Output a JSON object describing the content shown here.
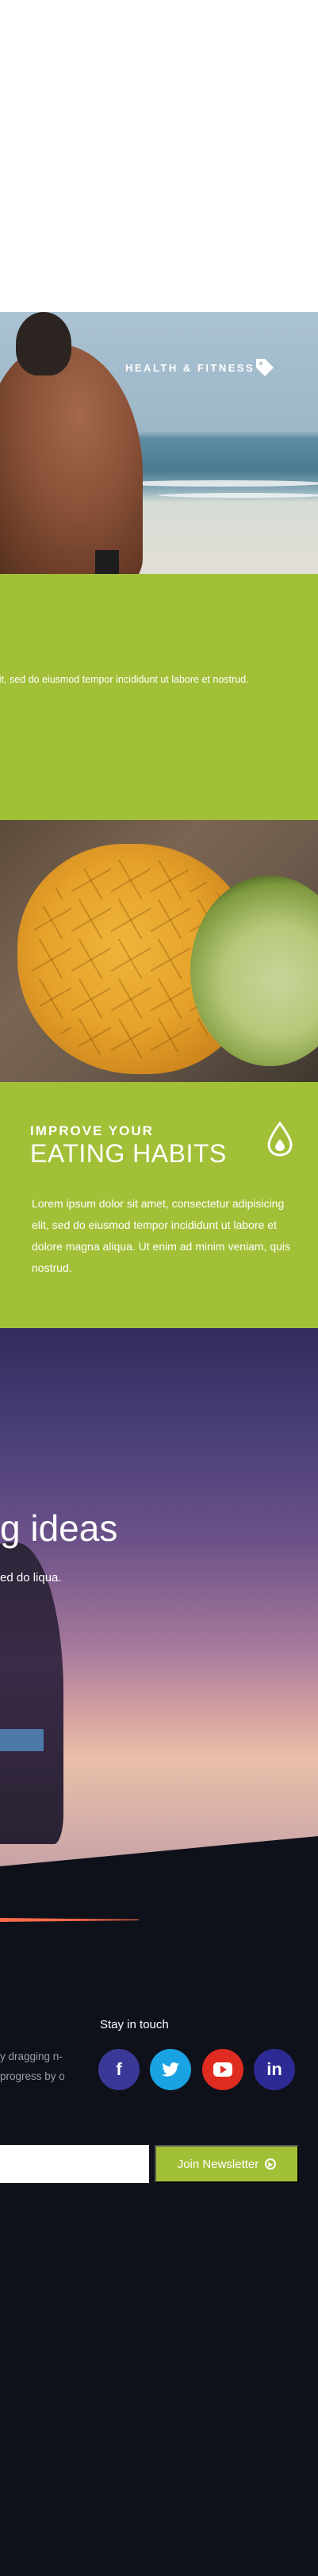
{
  "beach_section": {
    "caption": "HEALTH & FITNESS",
    "caption_icon": "tag-icon"
  },
  "green_section_one": {
    "body": "lit, sed do eiusmod tempor incididunt ut labore et nostrud."
  },
  "eating_habits": {
    "kicker": "IMPROVE YOUR",
    "title": "EATING HABITS",
    "icon": "drop-icon",
    "body": "Lorem ipsum dolor sit amet, consectetur adipisicing elit, sed do eiusmod tempor incididunt ut labore et dolore magna aliqua. Ut enim ad minim veniam, quis nostrud."
  },
  "sunset_section": {
    "headline": "g ideas",
    "body": "ed do liqua."
  },
  "footer": {
    "stay_title": "Stay in touch",
    "description": "y dragging n-progress by o",
    "social": [
      {
        "name": "facebook",
        "label": "f",
        "color": "#3b3997"
      },
      {
        "name": "twitter",
        "label": "🐦",
        "color": "#1aa3e3"
      },
      {
        "name": "youtube",
        "label": "▶",
        "color": "#e02b20"
      },
      {
        "name": "linkedin",
        "label": "in",
        "color": "#2c2a94"
      }
    ],
    "email_placeholder": "",
    "join_label": "Join Newsletter",
    "accent_color": "#ff6b4a"
  },
  "colors": {
    "green": "#a2c037",
    "footer_bg": "#0f111a"
  }
}
